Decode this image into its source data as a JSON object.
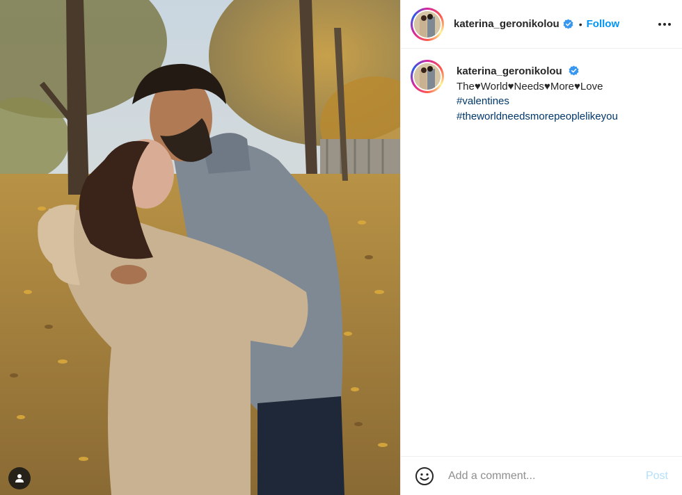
{
  "post": {
    "username": "katerina_geronikolou",
    "verified": true,
    "follow_label": "Follow",
    "separator": "•",
    "more_icon": "more-horizontal-icon",
    "caption": {
      "username": "katerina_geronikolou",
      "text": "The♥World♥Needs♥More♥Love",
      "hashtags": [
        "#valentines",
        "#theworldneedsmorepeoplelikeyou"
      ]
    }
  },
  "comment_box": {
    "placeholder": "Add a comment...",
    "post_label": "Post",
    "emoji_icon": "emoji-smile-icon"
  },
  "media": {
    "tag_icon": "user-tag-icon",
    "description_icon": "photo"
  },
  "colors": {
    "link_blue": "#0095f6",
    "hashtag_blue": "#00376b",
    "post_disabled": "#b2dffc",
    "verified_blue": "#3897f0"
  }
}
